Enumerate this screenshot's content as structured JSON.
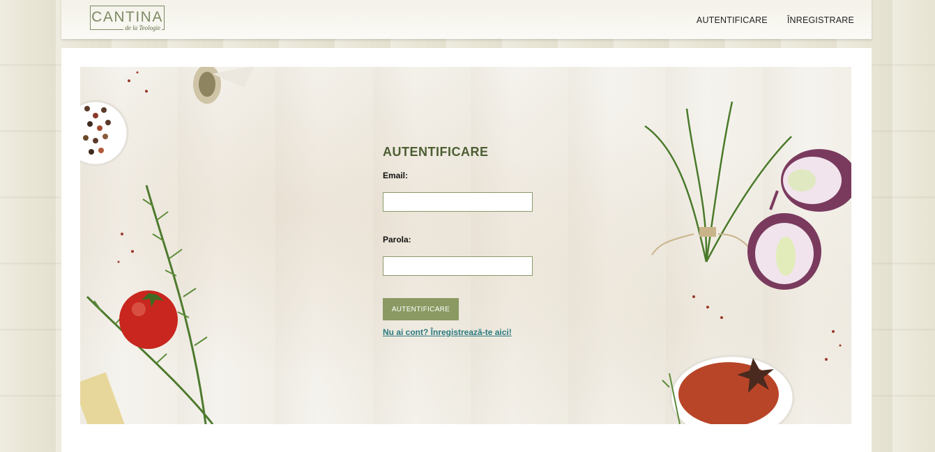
{
  "header": {
    "logo": {
      "main": "CANTINA",
      "sub": "de la Teologie"
    },
    "nav": [
      {
        "label": "AUTENTIFICARE"
      },
      {
        "label": "ÎNREGISTRARE"
      }
    ]
  },
  "login": {
    "title": "AUTENTIFICARE",
    "email_label": "Email:",
    "email_value": "",
    "password_label": "Parola:",
    "password_value": "",
    "submit_label": "AUTENTIFICARE",
    "register_link": "Nu ai cont? Înregistrează-te aici!"
  },
  "colors": {
    "accent": "#8a9a62",
    "title": "#4c5e32",
    "link": "#2a7a80"
  }
}
